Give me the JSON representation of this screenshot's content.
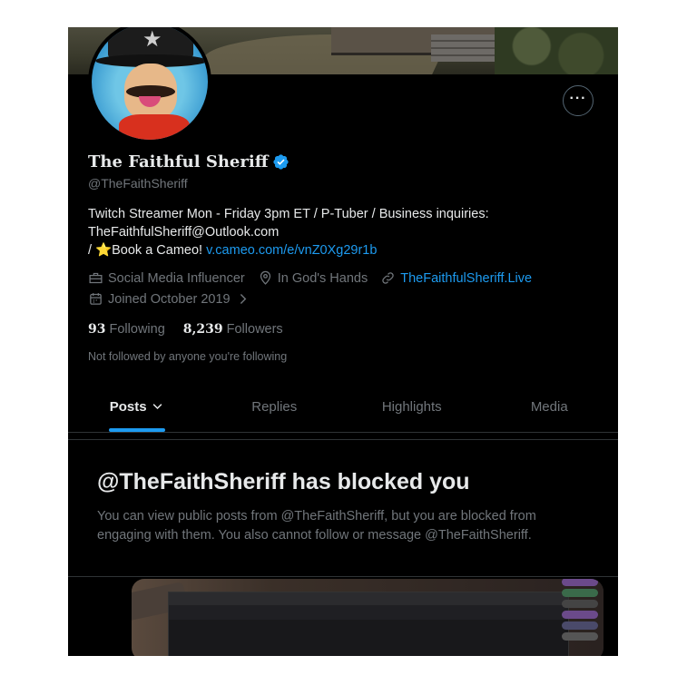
{
  "profile": {
    "display_name": "The Faithful Sheriff",
    "handle": "@TheFaithSheriff",
    "more_label": "···",
    "bio_line1": "Twitch Streamer Mon - Friday 3pm ET / P-Tuber /  Business inquiries:",
    "bio_line2": "TheFaithfulSheriff@Outlook.com",
    "bio_line3_prefix": "/ ",
    "bio_star": "⭐",
    "bio_cameo_text": "Book a Cameo! ",
    "bio_cameo_link": "v.cameo.com/e/vnZ0Xg29r1b",
    "category": "Social Media Influencer",
    "location": "In God's Hands",
    "website": "TheFaithfulSheriff.Live",
    "joined": "Joined October 2019",
    "following_count": "93",
    "following_label": "Following",
    "followers_count": "8,239",
    "followers_label": "Followers",
    "not_followed": "Not followed by anyone you're following"
  },
  "tabs": [
    {
      "label": "Posts",
      "active": true
    },
    {
      "label": "Replies",
      "active": false
    },
    {
      "label": "Highlights",
      "active": false
    },
    {
      "label": "Media",
      "active": false
    }
  ],
  "blocked": {
    "title": "@TheFaithSheriff has blocked you",
    "description": "You can view public posts from @TheFaithSheriff, but you are blocked from engaging with them. You also cannot follow or message @TheFaithSheriff."
  },
  "colors": {
    "background": "#000000",
    "accent": "#1d9bf0",
    "primary_text": "#e7e9ea",
    "secondary_text": "#71767b"
  },
  "icons": {
    "verified": "verified-badge-icon",
    "category": "briefcase-icon",
    "location": "location-pin-icon",
    "website": "link-icon",
    "joined": "calendar-icon",
    "more": "more-options-icon",
    "posts_dropdown": "chevron-down-icon"
  }
}
